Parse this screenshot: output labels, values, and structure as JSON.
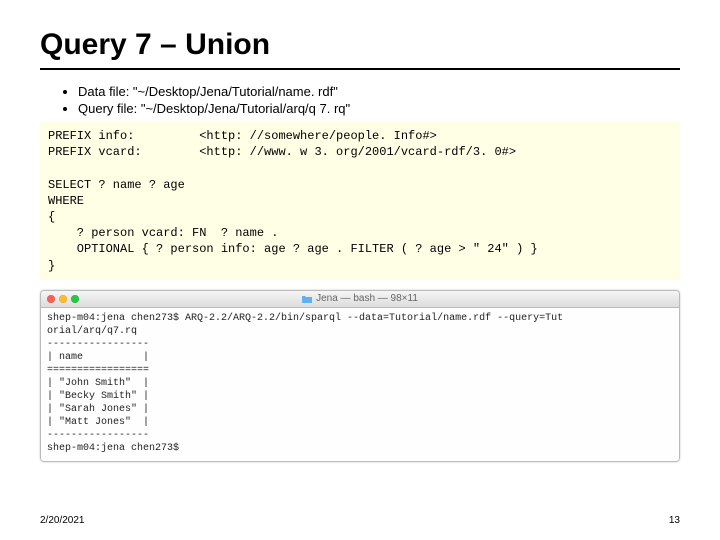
{
  "title": "Query 7 – Union",
  "bullets": [
    "Data file: \"~/Desktop/Jena/Tutorial/name. rdf\"",
    "Query file: \"~/Desktop/Jena/Tutorial/arq/q 7. rq\""
  ],
  "code": "PREFIX info:         <http: //somewhere/people. Info#>\nPREFIX vcard:        <http: //www. w 3. org/2001/vcard-rdf/3. 0#>\n\nSELECT ? name ? age\nWHERE\n{\n    ? person vcard: FN  ? name .\n    OPTIONAL { ? person info: age ? age . FILTER ( ? age > \" 24\" ) }\n}",
  "terminal": {
    "title": "Jena — bash — 98×11",
    "lines_top": "shep-m04:jena chen273$ ARQ-2.2/ARQ-2.2/bin/sparql --data=Tutorial/name.rdf --query=Tut\norial/arq/q7.rq",
    "table": "-----------------\n| name          |\n=================\n| \"John Smith\"  |\n| \"Becky Smith\" |\n| \"Sarah Jones\" |\n| \"Matt Jones\"  |\n-----------------",
    "prompt": "shep-m04:jena chen273$ "
  },
  "footer": {
    "date": "2/20/2021",
    "page": "13"
  }
}
